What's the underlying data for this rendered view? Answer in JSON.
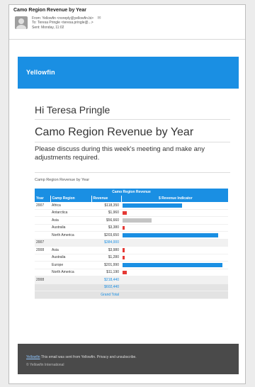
{
  "mail": {
    "subject": "Camo Region Revenue by Year",
    "from_line": "From: Yellowfin <noreply@yellowfin.bi>",
    "to_line": "To: Teresa Pringle <teresa.pringle@...>",
    "date_line": "Sent: Monday, 11:02"
  },
  "email": {
    "brand": "Yellowfin",
    "greeting": "Hi Teresa Pringle",
    "report_title": "Camo Region Revenue by Year",
    "message": "Please discuss during this week's meeting and make any adjustments required.",
    "table_caption": "Camp Region Revenue by Year",
    "footer_text": "This email was sent from Yellowfin. Privacy and unsubscribe.",
    "footer_link": "Yellowfin",
    "footer_small": "© Yellowfin International"
  },
  "table": {
    "title": "Camo Region Revenue",
    "headers": [
      "Year",
      "Camp Region",
      "Revenue",
      "$ Revenue Indicator"
    ]
  },
  "chart_data": {
    "type": "table",
    "rows": [
      {
        "year": "2007",
        "region": "Africa",
        "revenue": "$118,350",
        "indicator": 0.58,
        "kind": "pos"
      },
      {
        "year": "",
        "region": "Antarctica",
        "revenue": "$1,960",
        "indicator": 0.04,
        "kind": "neg"
      },
      {
        "year": "",
        "region": "Asia",
        "revenue": "$56,660",
        "indicator": 0.28,
        "kind": "grey"
      },
      {
        "year": "",
        "region": "Australia",
        "revenue": "$3,380",
        "indicator": 0.02,
        "kind": "neg"
      },
      {
        "year": "",
        "region": "North America",
        "revenue": "$203,650",
        "indicator": 0.93,
        "kind": "pos"
      },
      {
        "year": "2007",
        "region": "",
        "revenue": "$384,000",
        "indicator": 0,
        "kind": "sub"
      },
      {
        "year": "2008",
        "region": "Asia",
        "revenue": "$3,980",
        "indicator": 0.02,
        "kind": "neg"
      },
      {
        "year": "",
        "region": "Australia",
        "revenue": "$1,280",
        "indicator": 0.02,
        "kind": "neg"
      },
      {
        "year": "",
        "region": "Europe",
        "revenue": "$201,990",
        "indicator": 0.97,
        "kind": "pos"
      },
      {
        "year": "",
        "region": "North America",
        "revenue": "$11,190",
        "indicator": 0.04,
        "kind": "neg"
      },
      {
        "year": "2008",
        "region": "",
        "revenue": "$218,440",
        "indicator": 0,
        "kind": "sub"
      },
      {
        "year": "",
        "region": "",
        "revenue": "$602,440",
        "indicator": 0,
        "kind": "total"
      },
      {
        "year": "",
        "region": "",
        "revenue": "Grand Total",
        "indicator": 0,
        "kind": "total"
      }
    ]
  }
}
